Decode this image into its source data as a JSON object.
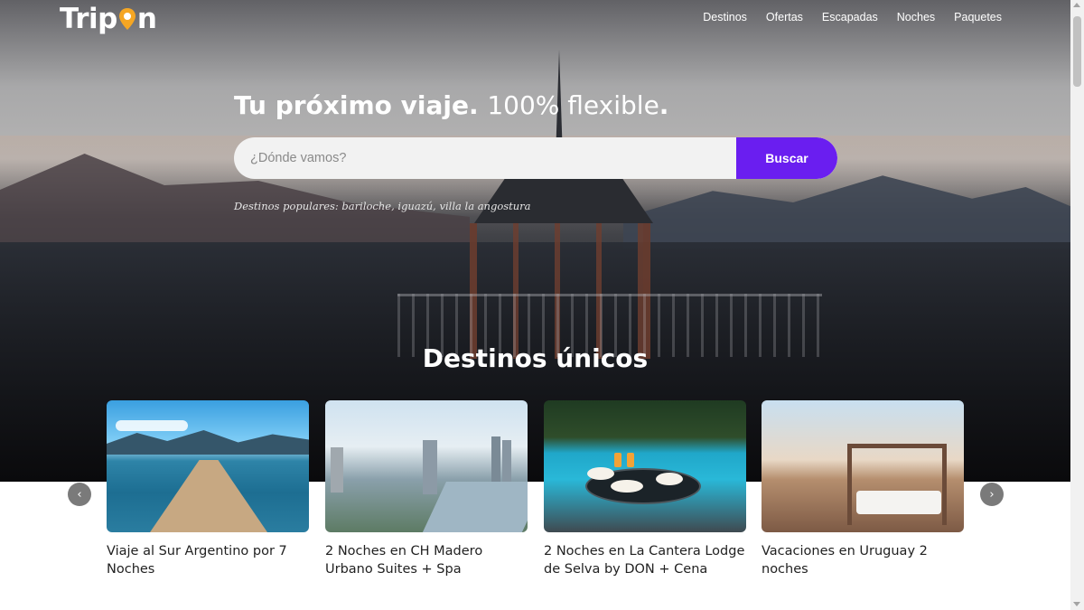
{
  "brand": {
    "logo_text_start": "Trip",
    "logo_text_end": "n",
    "logo_pin_color": "#f5a623",
    "accent": "#6a1ef0"
  },
  "nav": {
    "items": [
      {
        "label": "Destinos"
      },
      {
        "label": "Ofertas"
      },
      {
        "label": "Escapadas"
      },
      {
        "label": "Noches"
      },
      {
        "label": "Paquetes"
      }
    ]
  },
  "hero": {
    "headline_strong": "Tu próximo viaje.",
    "headline_light": "100% flexible",
    "headline_period": "."
  },
  "search": {
    "placeholder": "¿Dónde vamos?",
    "value": "",
    "button_label": "Buscar"
  },
  "popular": {
    "text": "Destinos populares: bariloche, iguazú, villa la angostura"
  },
  "section": {
    "title": "Destinos únicos"
  },
  "cards": [
    {
      "title": "Viaje al Sur Argentino por 7 Noches",
      "image": "lake-pier-image"
    },
    {
      "title": "2 Noches en CH Madero Urbano Suites + Spa",
      "image": "city-skyline-image"
    },
    {
      "title": "2 Noches en La Cantera Lodge de Selva by DON + Cena",
      "image": "pool-breakfast-image"
    },
    {
      "title": "Vacaciones en Uruguay 2 noches",
      "image": "terrace-daybed-image"
    }
  ],
  "carousel": {
    "prev_icon": "chevron-left-icon",
    "next_icon": "chevron-right-icon",
    "prev_glyph": "‹",
    "next_glyph": "›"
  }
}
